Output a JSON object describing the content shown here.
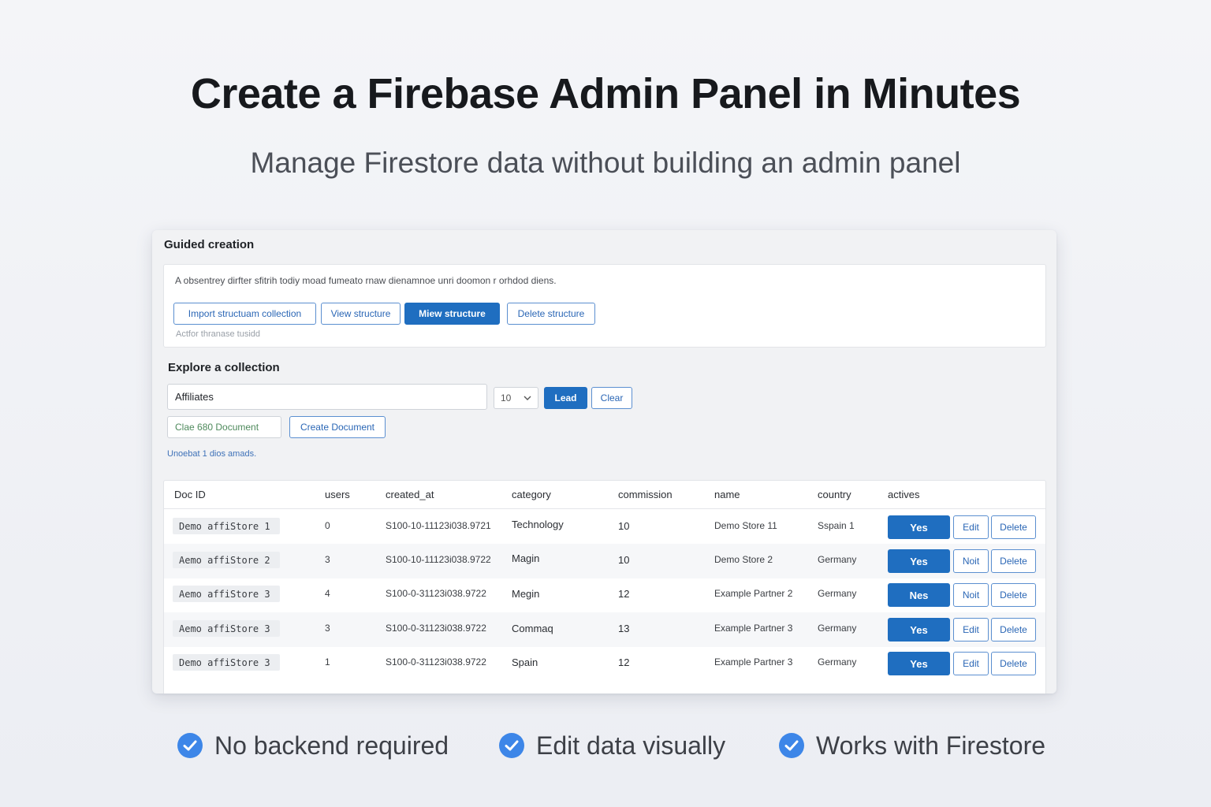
{
  "hero": {
    "title": "Create a Firebase Admin Panel in Minutes",
    "subtitle": "Manage Firestore data without building an admin panel"
  },
  "guided": {
    "title": "Guided creation",
    "description": "A obsentrey dirfter sfitrih todiy moad fumeato rnaw dienamnoe unri doomon r orhdod diens.",
    "buttons": {
      "import": "Import structuam collection",
      "view": "View structure",
      "view_primary": "Miew structure",
      "delete": "Delete structure"
    },
    "hint": "Actfor thranase tusidd"
  },
  "explore": {
    "title": "Explore a collection",
    "collection_value": "Affiliates",
    "limit_value": "10",
    "load_label": "Lead",
    "clear_label": "Clear",
    "doc_id_value": "Clae 680 Document",
    "create_label": "Create Document",
    "status": "Unoebat 1 dios amads."
  },
  "table": {
    "columns": [
      "Doc ID",
      "users",
      "created_at",
      "category",
      "commission",
      "name",
      "country",
      "actives"
    ],
    "rows": [
      {
        "doc_id": "Demo affiStore 1",
        "users": "0",
        "created_at": "S100-10-11123i038.9721",
        "category": "Technology",
        "commission": "10",
        "name": "Demo Store 11",
        "country": "Sspain 1",
        "active": "Yes",
        "edit": "Edit",
        "delete": "Delete"
      },
      {
        "doc_id": "Aemo affiStore 2",
        "users": "3",
        "created_at": "S100-10-11123i038.9722",
        "category": "Magin",
        "commission": "10",
        "name": "Demo Store 2",
        "country": "Germany",
        "active": "Yes",
        "edit": "Noit",
        "delete": "Delete"
      },
      {
        "doc_id": "Aemo affiStore 3",
        "users": "4",
        "created_at": "S100-0-31123i038.9722",
        "category": "Megin",
        "commission": "12",
        "name": "Example Partner 2",
        "country": "Germany",
        "active": "Nes",
        "edit": "Noit",
        "delete": "Delete"
      },
      {
        "doc_id": "Aemo affiStore 3",
        "users": "3",
        "created_at": "S100-0-31123i038.9722",
        "category": "Commaq",
        "commission": "13",
        "name": "Example Partner 3",
        "country": "Germany",
        "active": "Yes",
        "edit": "Edit",
        "delete": "Delete"
      },
      {
        "doc_id": "Demo affiStore 3",
        "users": "1",
        "created_at": "S100-0-31123i038.9722",
        "category": "Spain",
        "commission": "12",
        "name": "Example Partner 3",
        "country": "Germany",
        "active": "Yes",
        "edit": "Edit",
        "delete": "Delete"
      }
    ]
  },
  "features": [
    {
      "icon": "check-circle-icon",
      "label": "No backend required"
    },
    {
      "icon": "check-circle-icon",
      "label": "Edit data visually"
    },
    {
      "icon": "check-circle-icon",
      "label": "Works with Firestore"
    }
  ],
  "colors": {
    "primary": "#1f6ec0",
    "accent_check": "#3d86e8",
    "background": "#f1f2f5"
  }
}
